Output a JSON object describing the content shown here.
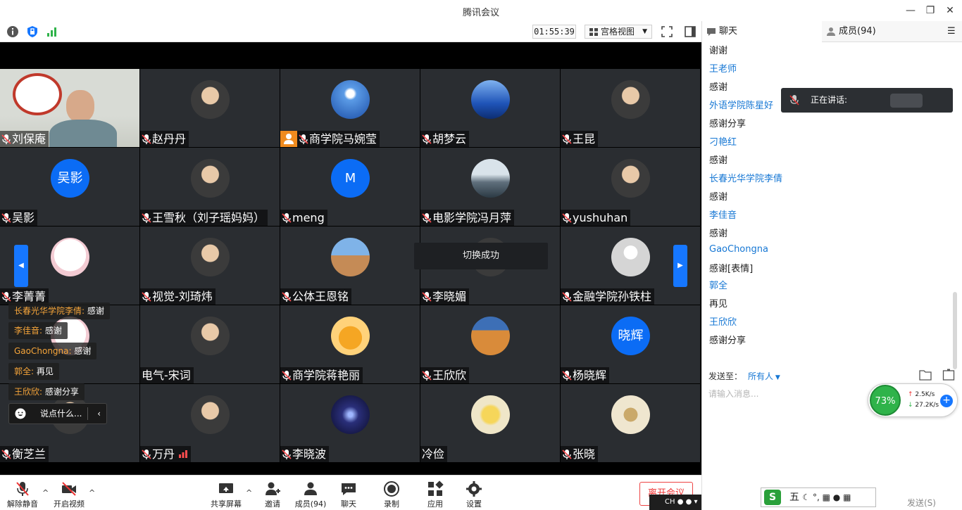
{
  "window": {
    "title": "腾讯会议"
  },
  "topbar": {
    "timer": "01:55:39",
    "view_label": "宫格视图"
  },
  "panel": {
    "tab_chat": "聊天",
    "tab_members": "成员(94)",
    "messages": [
      {
        "text": "谢谢",
        "kind": "text"
      },
      {
        "text": "王老师",
        "kind": "name"
      },
      {
        "text": "感谢",
        "kind": "text"
      },
      {
        "text": "外语学院陈星好",
        "kind": "name"
      },
      {
        "text": "感谢分享",
        "kind": "text"
      },
      {
        "text": "刁艳红",
        "kind": "name"
      },
      {
        "text": "感谢",
        "kind": "text"
      },
      {
        "text": "长春光华学院李倩",
        "kind": "name"
      },
      {
        "text": "感谢",
        "kind": "text"
      },
      {
        "text": "李佳音",
        "kind": "name"
      },
      {
        "text": "感谢",
        "kind": "text"
      },
      {
        "text": "GaoChongna",
        "kind": "name"
      },
      {
        "text": "感谢[表情]",
        "kind": "text"
      },
      {
        "text": "郭全",
        "kind": "name"
      },
      {
        "text": "再见",
        "kind": "text"
      },
      {
        "text": "王欣欣",
        "kind": "name"
      },
      {
        "text": "感谢分享",
        "kind": "text"
      }
    ],
    "speaking_label": "正在讲话:",
    "send_to_label": "发送至：",
    "send_to_target": "所有人",
    "input_placeholder": "请输入消息...",
    "send_button": "发送(S)"
  },
  "network": {
    "percent": "73%",
    "up": "2.5K/s",
    "down": "27.2K/s"
  },
  "stage": {
    "toast": "切换成功",
    "tiles": [
      {
        "name": "刘保庵",
        "avatar": "video"
      },
      {
        "name": "赵丹丹",
        "avatar": "photo"
      },
      {
        "name": "商学院马婉莹",
        "avatar": "sky"
      },
      {
        "name": "胡梦云",
        "avatar": "sea"
      },
      {
        "name": "王昆",
        "avatar": "photo"
      },
      {
        "name": "吴影",
        "avatar": "text",
        "avatar_text": "吴影"
      },
      {
        "name": "王雪秋（刘子瑶妈妈）",
        "avatar": "photo"
      },
      {
        "name": "meng",
        "avatar": "text",
        "avatar_text": "M"
      },
      {
        "name": "电影学院冯月萍",
        "avatar": "mountain"
      },
      {
        "name": "yushuhan",
        "avatar": "photo"
      },
      {
        "name": "李菁菁",
        "avatar": "cartoon"
      },
      {
        "name": "视觉-刘琦炜",
        "avatar": "photo"
      },
      {
        "name": "公体王恩铭",
        "avatar": "field"
      },
      {
        "name": "李晓媚",
        "avatar": "photo"
      },
      {
        "name": "金融学院孙铁柱",
        "avatar": "default"
      },
      {
        "name": "",
        "avatar": "cartoon"
      },
      {
        "name": "电气-宋词",
        "avatar": "photo"
      },
      {
        "name": "商学院蒋艳丽",
        "avatar": "tiger"
      },
      {
        "name": "王欣欣",
        "avatar": "desert"
      },
      {
        "name": "杨晓辉",
        "avatar": "text",
        "avatar_text": "晓辉"
      },
      {
        "name": "衡芝兰",
        "avatar": "photo"
      },
      {
        "name": "万丹",
        "avatar": "photo"
      },
      {
        "name": "李晓波",
        "avatar": "galaxy"
      },
      {
        "name": "冷俭",
        "avatar": "tulip"
      },
      {
        "name": "张晓",
        "avatar": "art"
      }
    ],
    "bubbles": [
      {
        "who": "长春光华学院李倩:",
        "text": " 感谢"
      },
      {
        "who": "李佳音:",
        "text": " 感谢"
      },
      {
        "who": "GaoChongna:",
        "text": " 感谢"
      },
      {
        "who": "郭全:",
        "text": " 再见"
      },
      {
        "who": "王欣欣:",
        "text": " 感谢分享"
      }
    ],
    "say_placeholder": "说点什么..."
  },
  "bottombar": {
    "unmute": "解除静音",
    "video": "开启视频",
    "share": "共享屏幕",
    "invite": "邀请",
    "members": "成员(94)",
    "chat": "聊天",
    "record": "录制",
    "apps": "应用",
    "settings": "设置",
    "leave": "离开会议"
  },
  "os": {
    "lang": "CH",
    "ime_text": "五"
  },
  "colors": {
    "accent": "#1677ff",
    "tile_bg": "#2a2d31",
    "name_blue": "#1677d4",
    "bubble_name": "#f6a53a"
  }
}
